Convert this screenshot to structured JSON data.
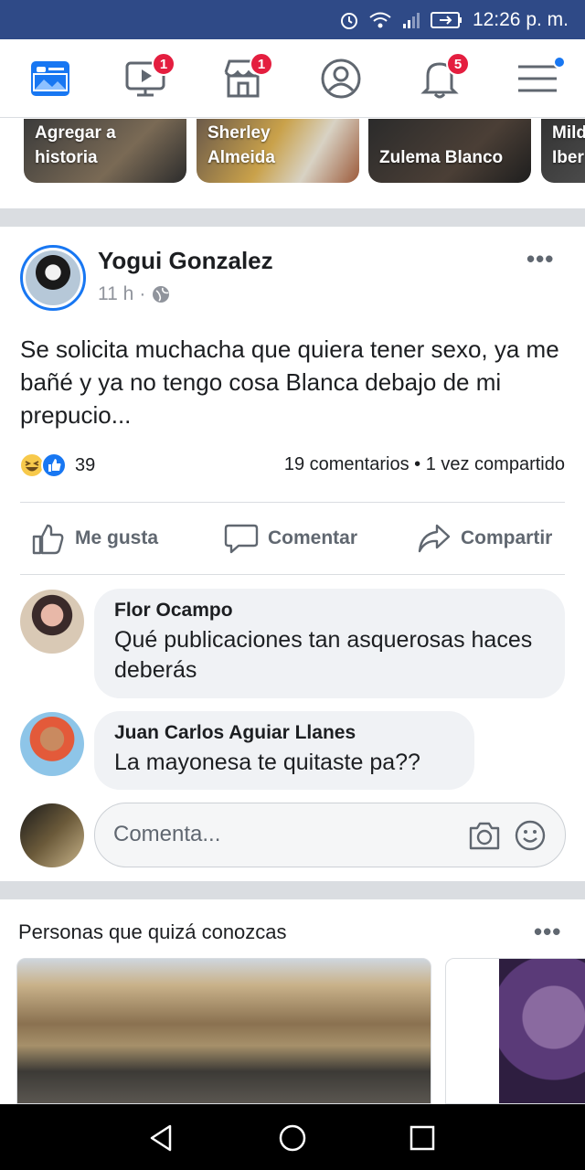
{
  "status_bar": {
    "time": "12:26 p. m."
  },
  "top_nav": {
    "items": [
      {
        "name": "news-feed",
        "badge": ""
      },
      {
        "name": "watch",
        "badge": "1"
      },
      {
        "name": "marketplace",
        "badge": "1"
      },
      {
        "name": "profile",
        "badge": ""
      },
      {
        "name": "notifications",
        "badge": "5"
      },
      {
        "name": "menu",
        "badge": ""
      }
    ]
  },
  "stories": [
    {
      "label": "Agregar a historia"
    },
    {
      "label": "Sherley Almeida"
    },
    {
      "label": "Zulema Blanco"
    },
    {
      "label": "Mild Iber"
    }
  ],
  "post": {
    "author": "Yogui Gonzalez",
    "time": "11 h",
    "privacy_icon": "globe-icon",
    "text": "Se solicita muchacha que quiera tener sexo, ya me bañé y ya no tengo cosa Blanca debajo de mi prepucio...",
    "reaction_count": "39",
    "stats": "19 comentarios • 1 vez compartido",
    "actions": {
      "like": "Me gusta",
      "comment": "Comentar",
      "share": "Compartir"
    }
  },
  "comments": [
    {
      "name": "Flor Ocampo",
      "text": "Qué publicaciones tan asquerosas haces deberás"
    },
    {
      "name": "Juan Carlos Aguiar Llanes",
      "text": "La mayonesa te quitaste pa??"
    }
  ],
  "composer": {
    "placeholder": "Comenta..."
  },
  "suggestions": {
    "title": "Personas que quizá conozcas"
  },
  "colors": {
    "status_bar": "#2f4a87",
    "accent": "#1877f2",
    "badge": "#e41e3f",
    "bubble": "#f0f2f5"
  }
}
